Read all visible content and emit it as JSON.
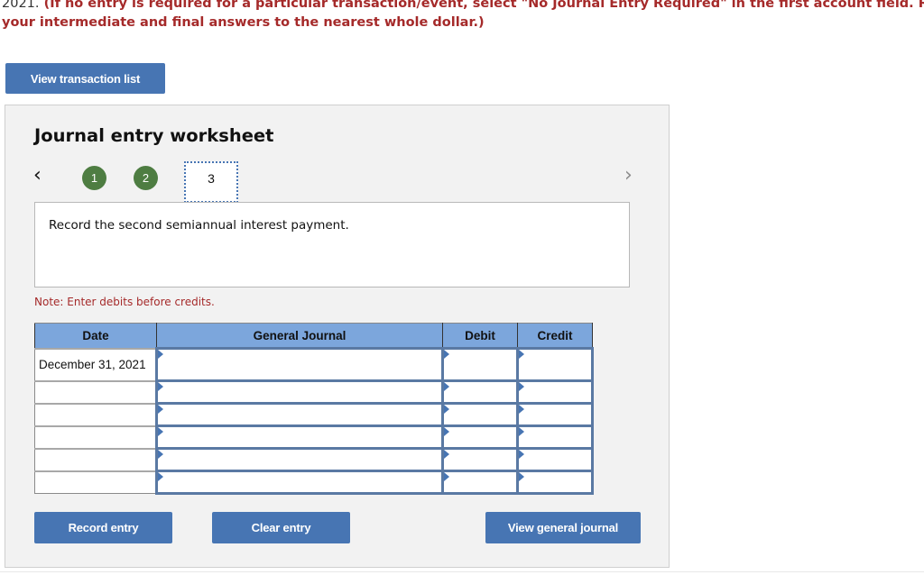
{
  "instructions": {
    "line1_plain": "2021.",
    "line1_bold": " (If no entry is required for a particular transaction/event, select \"No Journal Entry Required\" in the first account field. Round",
    "line2": "your intermediate and final answers to the nearest whole dollar.)"
  },
  "buttons": {
    "view_transaction_list": "View transaction list",
    "record_entry": "Record entry",
    "clear_entry": "Clear entry",
    "view_general_journal": "View general journal"
  },
  "worksheet": {
    "title": "Journal entry worksheet",
    "nav_prev_icon": "‹",
    "nav_next_icon": "›",
    "steps": [
      {
        "label": "1",
        "status": "completed"
      },
      {
        "label": "2",
        "status": "completed"
      },
      {
        "label": "3",
        "status": "active"
      }
    ],
    "description": "Record the second semiannual interest payment.",
    "note": "Note: Enter debits before credits."
  },
  "journal_table": {
    "headers": [
      "Date",
      "General Journal",
      "Debit",
      "Credit"
    ],
    "rows": [
      {
        "date": "December 31, 2021",
        "account": "",
        "debit": "",
        "credit": ""
      },
      {
        "date": "",
        "account": "",
        "debit": "",
        "credit": ""
      },
      {
        "date": "",
        "account": "",
        "debit": "",
        "credit": ""
      },
      {
        "date": "",
        "account": "",
        "debit": "",
        "credit": ""
      },
      {
        "date": "",
        "account": "",
        "debit": "",
        "credit": ""
      },
      {
        "date": "",
        "account": "",
        "debit": "",
        "credit": ""
      }
    ]
  },
  "colors": {
    "button_blue": "#4775b3",
    "header_blue": "#7ca6dc",
    "step_green": "#4e7d42",
    "alert_red": "#a52a2a"
  }
}
